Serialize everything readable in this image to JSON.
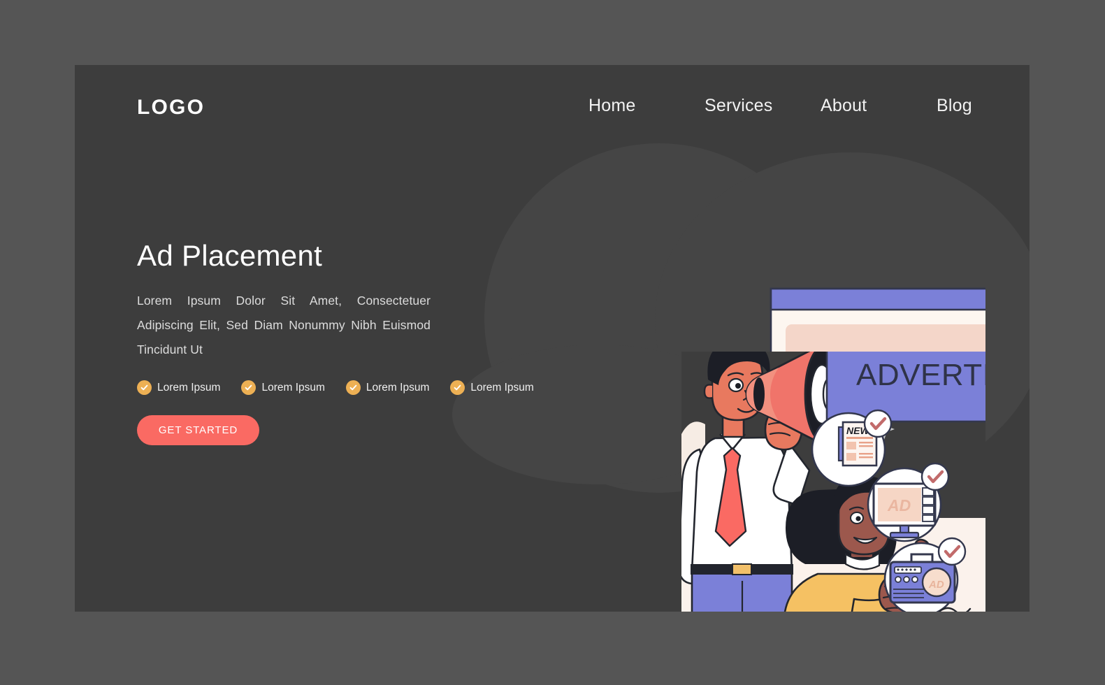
{
  "theme": {
    "outer_bg": "#555555",
    "card_bg": "#3d3d3d",
    "blob_bg": "#454545",
    "accent_coral": "#fa6a63",
    "accent_amber": "#edb054",
    "accent_periwinkle": "#7b80d8",
    "text_light": "#ffffff",
    "text_muted": "#dcdcdc"
  },
  "header": {
    "logo": "LOGO",
    "nav": [
      {
        "label": "Home"
      },
      {
        "label": "Services"
      },
      {
        "label": "About"
      },
      {
        "label": "Blog"
      }
    ]
  },
  "hero": {
    "title": "Ad Placement",
    "subtitle": "Lorem Ipsum Dolor Sit Amet, Consectetuer Adipiscing Elit, Sed Diam Nonummy Nibh Euismod Tincidunt Ut",
    "features": [
      {
        "label": "Lorem Ipsum",
        "icon": "check-circle-icon"
      },
      {
        "label": "Lorem Ipsum",
        "icon": "check-circle-icon"
      },
      {
        "label": "Lorem Ipsum",
        "icon": "check-circle-icon"
      },
      {
        "label": "Lorem Ipsum",
        "icon": "check-circle-icon"
      }
    ],
    "cta_label": "GET STARTED"
  },
  "illustration": {
    "banner_text": "ADVERTISING",
    "badges": [
      {
        "icon": "newspaper-icon",
        "label": "NEW"
      },
      {
        "icon": "monitor-icon",
        "label": "AD"
      },
      {
        "icon": "radio-icon",
        "label": "AD"
      }
    ]
  }
}
